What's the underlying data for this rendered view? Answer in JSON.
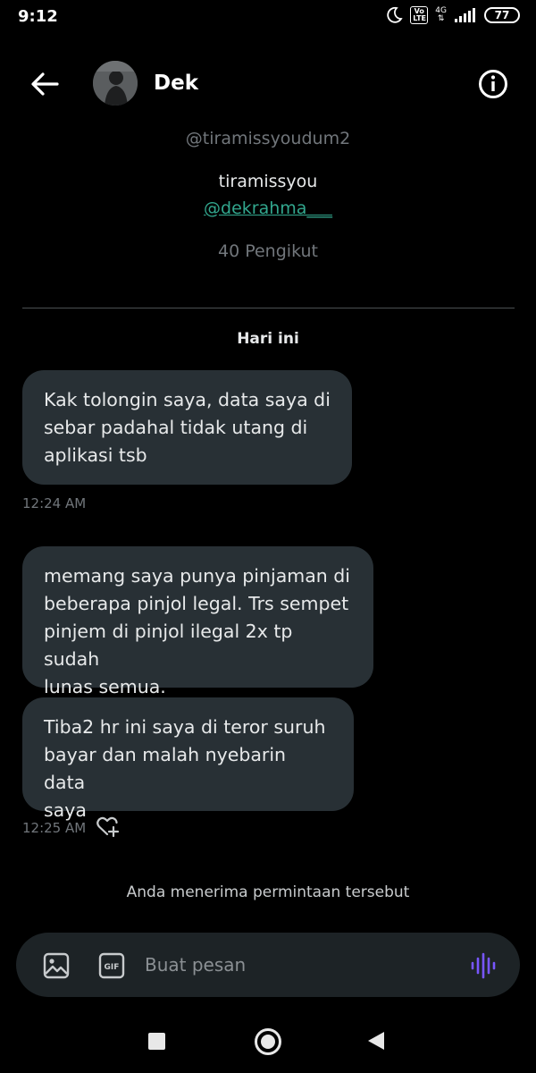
{
  "status_bar": {
    "time": "9:12",
    "volte": "Vo LTE",
    "network": "4G",
    "battery": "77",
    "icons": [
      "moon-icon",
      "volte-icon",
      "network-icon",
      "signal-icon",
      "battery-icon"
    ]
  },
  "header": {
    "name": "Dek",
    "back_icon": "arrow-left-icon",
    "info_icon": "info-icon"
  },
  "profile": {
    "handle": "@tiramissyoudum2",
    "bio": "tiramissyou",
    "mention": "@dekrahma___",
    "followers": "40 Pengikut"
  },
  "conversation": {
    "date_label": "Hari ini",
    "messages": [
      {
        "text": "Kak tolongin saya, data saya di\nsebar padahal tidak utang di\naplikasi tsb"
      },
      {
        "text": "memang saya punya pinjaman di\nbeberapa pinjol legal. Trs sempet\npinjem di pinjol ilegal 2x tp sudah\nlunas semua."
      },
      {
        "text": "Tiba2 hr ini saya di teror suruh\nbayar dan malah nyebarin data\nsaya"
      }
    ],
    "times": [
      "12:24 AM",
      "12:25 AM"
    ],
    "accepted_note": "Anda menerima permintaan tersebut"
  },
  "composer": {
    "placeholder": "Buat pesan",
    "gif_label": "GIF"
  },
  "colors": {
    "background": "#000000",
    "bubble": "#283035",
    "muted_text": "#71767b",
    "mention": "#32a78e",
    "voice_accent": "#7856ff"
  }
}
